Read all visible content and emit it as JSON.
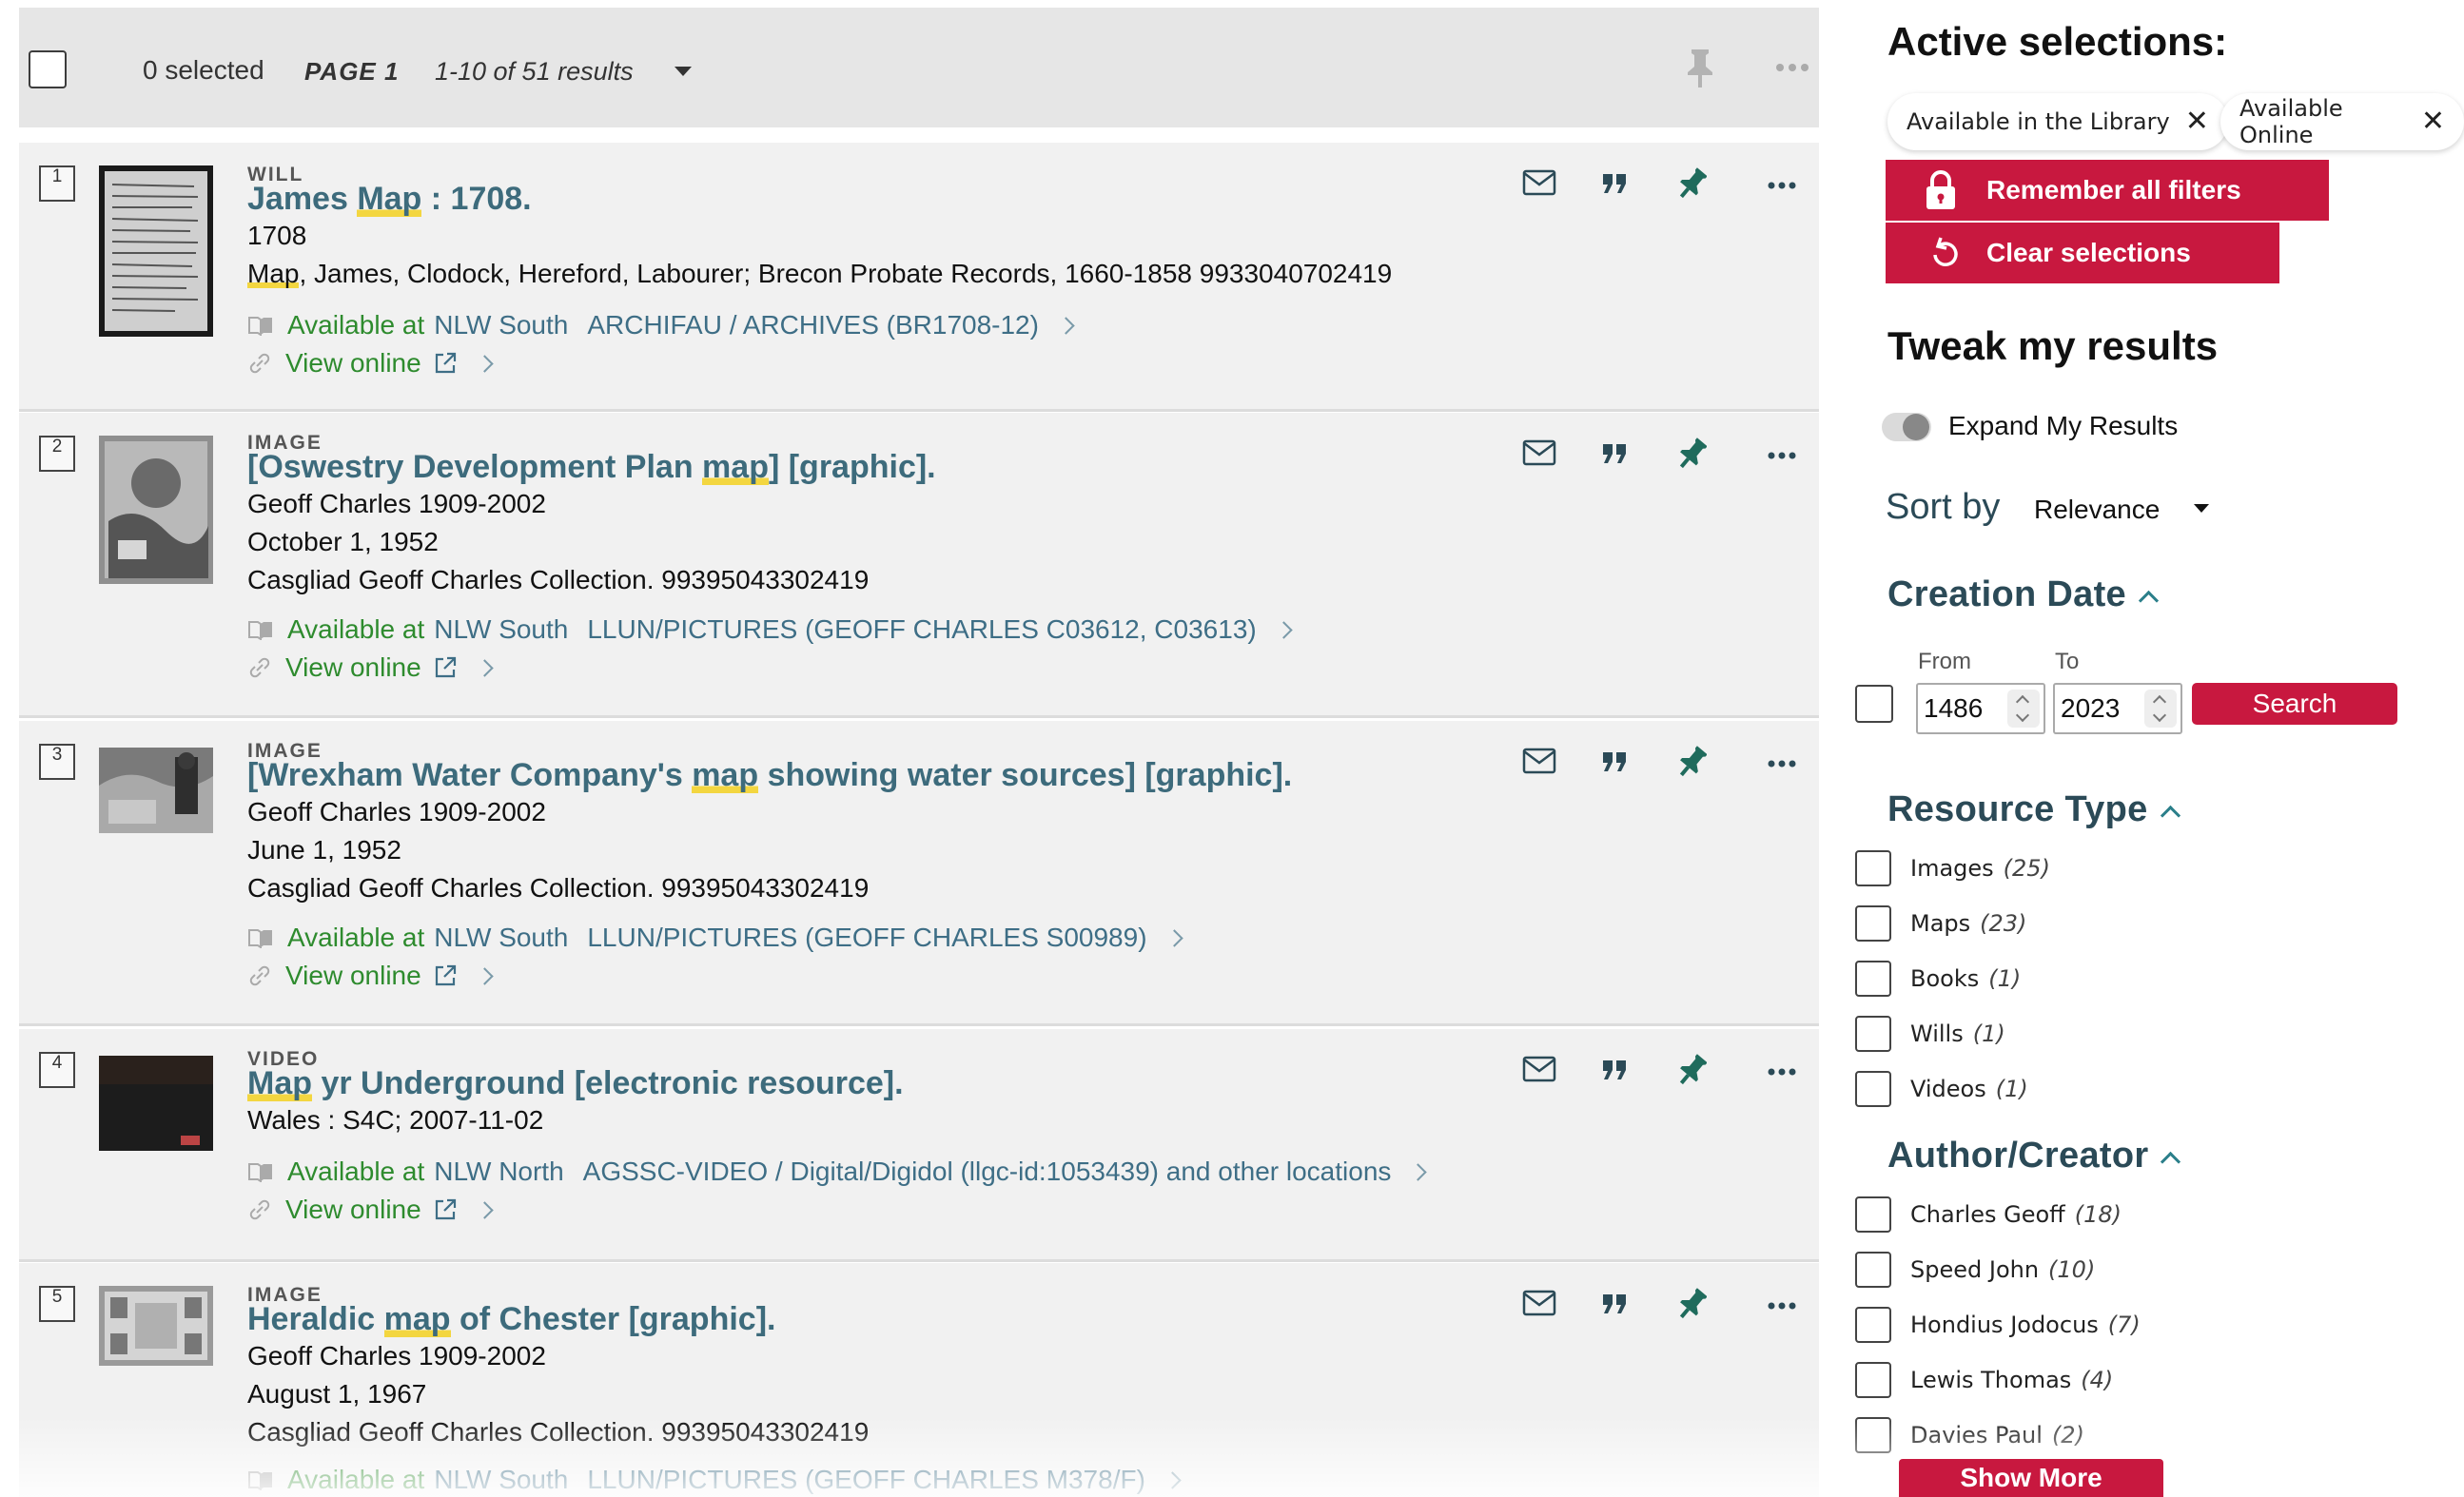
{
  "toolbar": {
    "selected": "0 selected",
    "page": "PAGE 1",
    "results": "1-10 of 51 results"
  },
  "results": [
    {
      "rank": "1",
      "type": "WILL",
      "title_pre": "James ",
      "title_hl": "Map",
      "title_post": " : 1708.",
      "line1": "1708",
      "line2_hl": "Map",
      "line2_post": ", James, Clodock, Hereford, Labourer; Brecon Probate Records, 1660-1858 9933040702419",
      "available_label": "Available at",
      "library": "NLW South",
      "location": "ARCHIFAU / ARCHIVES (BR1708-12)",
      "view_online": "View online"
    },
    {
      "rank": "2",
      "type": "IMAGE",
      "title_pre": "[Oswestry Development Plan ",
      "title_hl": "map",
      "title_post": "] [graphic].",
      "line1": "Geoff Charles 1909-2002",
      "line2": "October 1, 1952",
      "line3": "Casgliad Geoff Charles Collection. 99395043302419",
      "available_label": "Available at",
      "library": "NLW South",
      "location": "LLUN/PICTURES (GEOFF CHARLES C03612, C03613)",
      "view_online": "View online"
    },
    {
      "rank": "3",
      "type": "IMAGE",
      "title_pre": "[Wrexham Water Company's ",
      "title_hl": "map",
      "title_post": " showing water sources] [graphic].",
      "line1": "Geoff Charles 1909-2002",
      "line2": "June 1, 1952",
      "line3": "Casgliad Geoff Charles Collection. 99395043302419",
      "available_label": "Available at",
      "library": "NLW South",
      "location": "LLUN/PICTURES (GEOFF CHARLES S00989)",
      "view_online": "View online"
    },
    {
      "rank": "4",
      "type": "VIDEO",
      "title_pre": "",
      "title_hl": "Map",
      "title_post": " yr Underground [electronic resource].",
      "line1": "Wales : S4C; 2007-11-02",
      "available_label": "Available at",
      "library": "NLW North",
      "location": "AGSSC-VIDEO / Digital/Digidol (llgc-id:1053439) and other locations",
      "view_online": "View online"
    },
    {
      "rank": "5",
      "type": "IMAGE",
      "title_pre": "Heraldic ",
      "title_hl": "map",
      "title_post": " of Chester [graphic].",
      "line1": "Geoff Charles 1909-2002",
      "line2": "August 1, 1967",
      "line3": "Casgliad Geoff Charles Collection. 99395043302419",
      "available_label": "Available at",
      "library": "NLW South",
      "location": "LLUN/PICTURES (GEOFF CHARLES M378/F)"
    }
  ],
  "sidebar": {
    "active_title": "Active selections:",
    "chips": [
      "Available in the Library",
      "Available Online"
    ],
    "remember_btn": "Remember all filters",
    "clear_btn": "Clear selections",
    "tweak_title": "Tweak my results",
    "expand_label": "Expand My Results",
    "sort_label": "Sort by",
    "sort_value": "Relevance",
    "creation_date": {
      "title": "Creation Date",
      "from_label": "From",
      "to_label": "To",
      "from_value": "1486",
      "to_value": "2023",
      "search_btn": "Search"
    },
    "resource_type": {
      "title": "Resource Type",
      "items": [
        {
          "label": "Images",
          "count": "(25)"
        },
        {
          "label": "Maps",
          "count": "(23)"
        },
        {
          "label": "Books",
          "count": "(1)"
        },
        {
          "label": "Wills",
          "count": "(1)"
        },
        {
          "label": "Videos",
          "count": "(1)"
        }
      ]
    },
    "author": {
      "title": "Author/Creator",
      "items": [
        {
          "label": "Charles Geoff",
          "count": "(18)"
        },
        {
          "label": "Speed John",
          "count": "(10)"
        },
        {
          "label": "Hondius Jodocus",
          "count": "(7)"
        },
        {
          "label": "Lewis Thomas",
          "count": "(4)"
        },
        {
          "label": "Davies Paul",
          "count": "(2)"
        }
      ]
    },
    "show_more": "Show More"
  },
  "colors": {
    "accent_red": "#c8183f",
    "title_teal": "#3d6b7c",
    "available_green": "#2e8b2e",
    "link_blue": "#3e6e86",
    "highlight_yellow": "#f3d640"
  }
}
